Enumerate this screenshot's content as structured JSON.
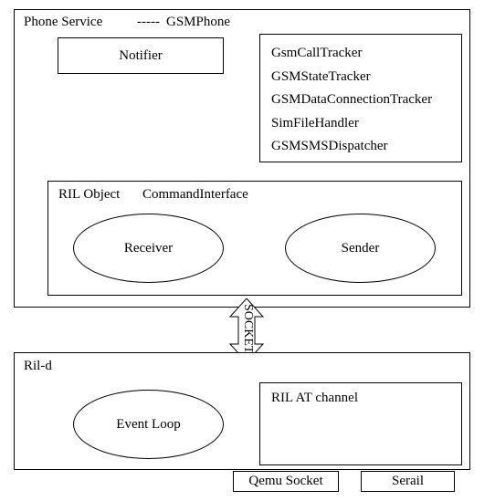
{
  "phoneService": {
    "title_left": "Phone Service",
    "title_dash": "-----",
    "title_right": "GSMPhone",
    "notifier": "Notifier",
    "trackers": [
      "GsmCallTracker",
      "GSMStateTracker",
      "GSMDataConnectionTracker",
      "SimFileHandler",
      "GSMSMSDispatcher"
    ],
    "ril_object": {
      "title_left": "RIL Object",
      "title_right": "CommandInterface",
      "receiver": "Receiver",
      "sender": "Sender"
    }
  },
  "connector": "SOCKET",
  "rild": {
    "title": "Ril-d",
    "event_loop": "Event Loop",
    "at_channel": "RIL AT channel"
  },
  "bottom": {
    "qemu": "Qemu Socket",
    "serial": "Serail"
  }
}
